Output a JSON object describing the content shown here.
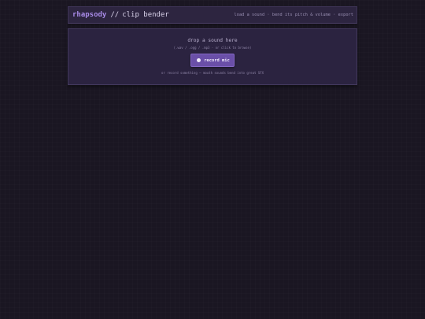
{
  "header": {
    "brand": "rhapsody",
    "separator": "//",
    "title": "clip bender",
    "tagline": "load a sound · bend its pitch & volume · export"
  },
  "dropzone": {
    "title": "drop a sound here",
    "subtitle": "(.wav / .ogg / .mp3 · or click to browse)",
    "record_button": "record mic",
    "hint": "or record something — mouth sounds bend into great SFX"
  },
  "colors": {
    "background": "#1a1622",
    "panel": "#2b2340",
    "accent": "#a98be8",
    "button": "#6a4fa8"
  },
  "icons": {
    "record": "record-dot-icon"
  }
}
